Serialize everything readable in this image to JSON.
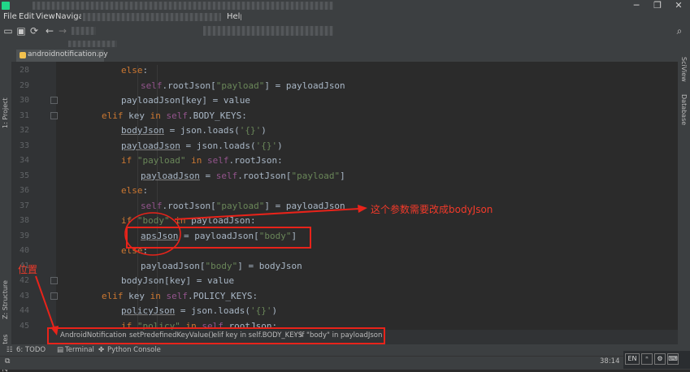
{
  "menu": [
    "File",
    "Edit",
    "View",
    "Navigate",
    "Help"
  ],
  "editor_tab": {
    "label": "androidnotification.py",
    "close": "×"
  },
  "sidebars": {
    "project": "1: Project",
    "structure": "Z: Structure",
    "favorites": "2: Favorites",
    "sciview": "SciView",
    "database": "Database"
  },
  "code_lines": [
    {
      "n": "28",
      "tokens": [
        {
          "t": "else",
          "c": "kw"
        },
        {
          "t": ":",
          "c": "id"
        }
      ]
    },
    {
      "n": "29",
      "tokens": [
        {
          "t": "self",
          "c": "sf"
        },
        {
          "t": ".rootJson[",
          "c": "id"
        },
        {
          "t": "\"payload\"",
          "c": "str"
        },
        {
          "t": "] = payloadJson",
          "c": "id"
        }
      ]
    },
    {
      "n": "30",
      "tokens": [
        {
          "t": "payloadJson[key] = value",
          "c": "id"
        }
      ]
    },
    {
      "n": "31",
      "tokens": [
        {
          "t": "elif ",
          "c": "kw"
        },
        {
          "t": "key ",
          "c": "id"
        },
        {
          "t": "in ",
          "c": "kw"
        },
        {
          "t": "self",
          "c": "sf"
        },
        {
          "t": ".BODY_KEYS:",
          "c": "id"
        }
      ]
    },
    {
      "n": "32",
      "tokens": [
        {
          "t": "bodyJson",
          "c": "id ul"
        },
        {
          "t": " = json.loads(",
          "c": "id"
        },
        {
          "t": "'{}'",
          "c": "str"
        },
        {
          "t": ")",
          "c": "id"
        }
      ]
    },
    {
      "n": "33",
      "tokens": [
        {
          "t": "payloadJson",
          "c": "id ul"
        },
        {
          "t": " = json.loads(",
          "c": "id"
        },
        {
          "t": "'{}'",
          "c": "str"
        },
        {
          "t": ")",
          "c": "id"
        }
      ]
    },
    {
      "n": "34",
      "tokens": [
        {
          "t": "if ",
          "c": "kw"
        },
        {
          "t": "\"payload\" ",
          "c": "str"
        },
        {
          "t": "in ",
          "c": "kw"
        },
        {
          "t": "self",
          "c": "sf"
        },
        {
          "t": ".rootJson:",
          "c": "id"
        }
      ]
    },
    {
      "n": "35",
      "tokens": [
        {
          "t": "payloadJson",
          "c": "id ul"
        },
        {
          "t": " = ",
          "c": "id"
        },
        {
          "t": "self",
          "c": "sf"
        },
        {
          "t": ".rootJson[",
          "c": "id"
        },
        {
          "t": "\"payload\"",
          "c": "str"
        },
        {
          "t": "]",
          "c": "id"
        }
      ]
    },
    {
      "n": "36",
      "tokens": [
        {
          "t": "else",
          "c": "kw"
        },
        {
          "t": ":",
          "c": "id"
        }
      ]
    },
    {
      "n": "37",
      "tokens": [
        {
          "t": "self",
          "c": "sf"
        },
        {
          "t": ".rootJson[",
          "c": "id"
        },
        {
          "t": "\"payload\"",
          "c": "str"
        },
        {
          "t": "] = payloadJson",
          "c": "id"
        }
      ]
    },
    {
      "n": "38",
      "tokens": [
        {
          "t": "if ",
          "c": "kw"
        },
        {
          "t": "\"body\" ",
          "c": "str"
        },
        {
          "t": "in ",
          "c": "kw"
        },
        {
          "t": "payloadJson:",
          "c": "id"
        }
      ]
    },
    {
      "n": "39",
      "tokens": [
        {
          "t": "apsJson",
          "c": "id ul"
        },
        {
          "t": " = payloadJson[",
          "c": "id"
        },
        {
          "t": "\"body\"",
          "c": "str"
        },
        {
          "t": "]",
          "c": "id"
        }
      ]
    },
    {
      "n": "40",
      "tokens": [
        {
          "t": "else",
          "c": "kw"
        },
        {
          "t": ":",
          "c": "id"
        }
      ]
    },
    {
      "n": "41",
      "tokens": [
        {
          "t": "payloadJson[",
          "c": "id"
        },
        {
          "t": "\"body\"",
          "c": "str"
        },
        {
          "t": "] = bodyJson",
          "c": "id"
        }
      ]
    },
    {
      "n": "42",
      "tokens": [
        {
          "t": "bodyJson[key] = value",
          "c": "id"
        }
      ]
    },
    {
      "n": "43",
      "tokens": [
        {
          "t": "elif ",
          "c": "kw"
        },
        {
          "t": "key ",
          "c": "id"
        },
        {
          "t": "in ",
          "c": "kw"
        },
        {
          "t": "self",
          "c": "sf"
        },
        {
          "t": ".POLICY_KEYS:",
          "c": "id"
        }
      ]
    },
    {
      "n": "44",
      "tokens": [
        {
          "t": "policyJson",
          "c": "id ul"
        },
        {
          "t": " = json.loads(",
          "c": "id"
        },
        {
          "t": "'{}'",
          "c": "str"
        },
        {
          "t": ")",
          "c": "id"
        }
      ]
    },
    {
      "n": "45",
      "tokens": [
        {
          "t": "if ",
          "c": "kw"
        },
        {
          "t": "\"policy\" ",
          "c": "str"
        },
        {
          "t": "in ",
          "c": "kw"
        },
        {
          "t": "self",
          "c": "sf"
        },
        {
          "t": ".rootJson:",
          "c": "id"
        }
      ]
    }
  ],
  "breadcrumb": [
    "AndroidNotification",
    "setPredefinedKeyValue()",
    "elif key in self.BODY_KEYS",
    "if \"body\" in payloadJson"
  ],
  "bottom_tools": [
    "6: TODO",
    "Terminal",
    "Python Console"
  ],
  "status": {
    "position": "38:14"
  },
  "tray": {
    "lang": "EN"
  },
  "annotations": {
    "right_note": "这个参数需要改成bodyJson",
    "left_note": "位置"
  },
  "colors": {
    "annotation": "#e8231a",
    "keyword": "#cc7832",
    "string": "#6a8759",
    "self": "#94558d"
  }
}
